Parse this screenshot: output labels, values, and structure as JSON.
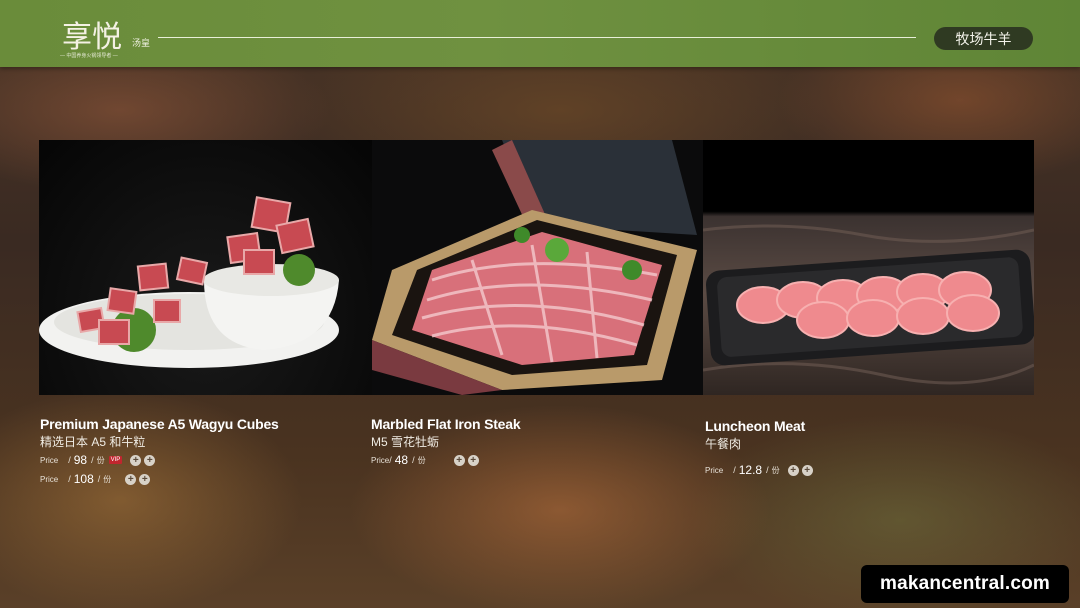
{
  "header": {
    "logo_text": "享悦",
    "logo_sub": "汤皇",
    "logo_tag": "— 中国养身火锅领导者 —",
    "category": "牧场牛羊"
  },
  "products": [
    {
      "name_en": "Premium Japanese A5 Wagyu Cubes",
      "name_cn": "精选日本 A5 和牛粒",
      "prices": [
        {
          "label": "Price",
          "value": "98",
          "unit": "份",
          "badge": "VIP"
        },
        {
          "label": "Price",
          "value": "108",
          "unit": "份"
        }
      ]
    },
    {
      "name_en": "Marbled Flat Iron Steak",
      "name_cn": "M5 雪花牡蛎",
      "prices": [
        {
          "label": "Price",
          "value": "48",
          "unit": "份"
        }
      ]
    },
    {
      "name_en": "Luncheon Meat",
      "name_cn": "午餐肉",
      "prices": [
        {
          "label": "Price",
          "value": "12.8",
          "unit": "份"
        }
      ]
    }
  ],
  "icons": {
    "plus": "+",
    "slash": "/"
  },
  "watermark": "makancentral.com"
}
